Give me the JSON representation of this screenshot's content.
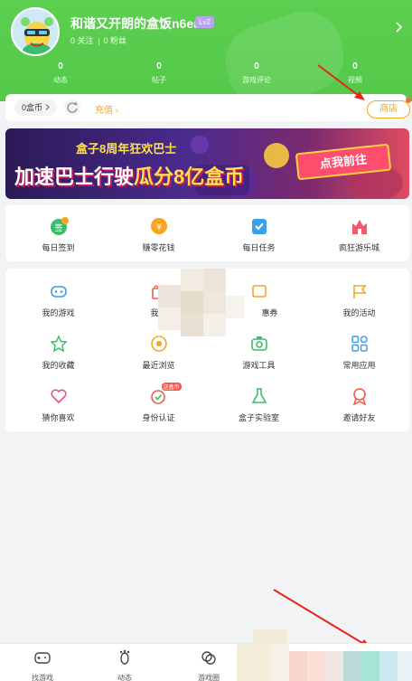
{
  "profile": {
    "username": "和谐又开朗的盒饭n6ea",
    "level": "Lv2",
    "following": "0 关注",
    "followers": "0 粉丝"
  },
  "stats": [
    {
      "value": "0",
      "label": "动态"
    },
    {
      "value": "0",
      "label": "帖子"
    },
    {
      "value": "0",
      "label": "游戏评论"
    },
    {
      "value": "0",
      "label": "视频"
    }
  ],
  "wallet": {
    "coins": "0盒币",
    "recharge": "充值",
    "shop": "商店"
  },
  "banner": {
    "subtitle": "盒子8周年狂欢巴士",
    "headline_left": "加速巴士行驶",
    "headline_right": "瓜分8亿盒币",
    "cta": "点我前往"
  },
  "quick_actions": [
    {
      "label": "每日签到",
      "icon": "checkin-icon",
      "badge": "+5"
    },
    {
      "label": "赚零花钱",
      "icon": "coin-icon"
    },
    {
      "label": "每日任务",
      "icon": "task-icon"
    },
    {
      "label": "疯狂游乐城",
      "icon": "castle-icon"
    }
  ],
  "menu": [
    {
      "label": "我的游戏",
      "icon": "gamepad-icon",
      "color": "#3aa0e8"
    },
    {
      "label": "我的",
      "icon": "gift-icon",
      "color": "#f15a4a"
    },
    {
      "label": "惠券",
      "icon": "coupon-icon",
      "color": "#f5a623"
    },
    {
      "label": "我的活动",
      "icon": "flag-icon",
      "color": "#f5a623"
    },
    {
      "label": "我的收藏",
      "icon": "star-icon",
      "color": "#3dbd6a"
    },
    {
      "label": "最近浏览",
      "icon": "eye-icon",
      "color": "#f5a623"
    },
    {
      "label": "游戏工具",
      "icon": "camera-icon",
      "color": "#3dbd6a"
    },
    {
      "label": "常用应用",
      "icon": "apps-icon",
      "color": "#3aa0e8"
    },
    {
      "label": "猜你喜欢",
      "icon": "heart-icon",
      "color": "#e8527a"
    },
    {
      "label": "身份认证",
      "icon": "verified-icon",
      "color": "#f15a4a",
      "badge": "送盒币"
    },
    {
      "label": "盒子实验室",
      "icon": "flask-icon",
      "color": "#3dbd6a"
    },
    {
      "label": "邀请好友",
      "icon": "medal-icon",
      "color": "#f15a4a"
    }
  ],
  "tabs": [
    {
      "label": "找游戏",
      "icon": "controller-icon"
    },
    {
      "label": "动态",
      "icon": "footprint-icon"
    },
    {
      "label": "游戏圈",
      "icon": "circles-icon"
    }
  ],
  "colors": {
    "header_green": "#54c848",
    "accent_orange": "#f5a623",
    "annotation_red": "#e8261e"
  }
}
